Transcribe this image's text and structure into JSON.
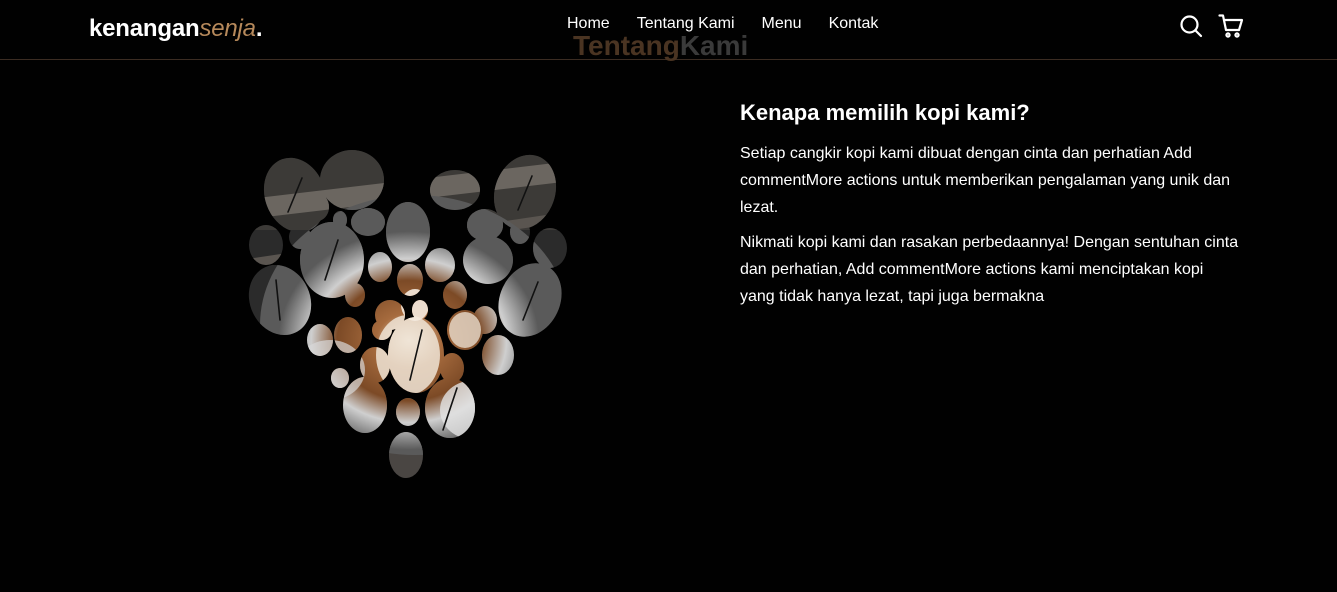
{
  "brand": {
    "part1": "kenangan",
    "part2": "senja",
    "part3": "."
  },
  "nav": [
    {
      "label": "Home"
    },
    {
      "label": "Tentang Kami"
    },
    {
      "label": "Menu"
    },
    {
      "label": "Kontak"
    }
  ],
  "icons": {
    "search": "search-icon",
    "cart": "shopping-cart-icon"
  },
  "section": {
    "title_part1": "Tentang",
    "title_part2": "Kami"
  },
  "about": {
    "heading": "Kenapa memilih kopi kami?",
    "paragraph1": "Setiap cangkir kopi kami dibuat dengan cinta dan perhatian Add commentMore actions untuk memberikan pengalaman yang unik dan lezat.",
    "paragraph2": "Nikmati kopi kami dan rasakan perbedaannya! Dengan sentuhan cinta dan perhatian, Add commentMore actions kami menciptakan kopi yang tidak hanya lezat, tapi juga bermakna"
  },
  "colors": {
    "accent": "#b6895b",
    "background": "#010101",
    "title_dim": "#4a3422"
  }
}
